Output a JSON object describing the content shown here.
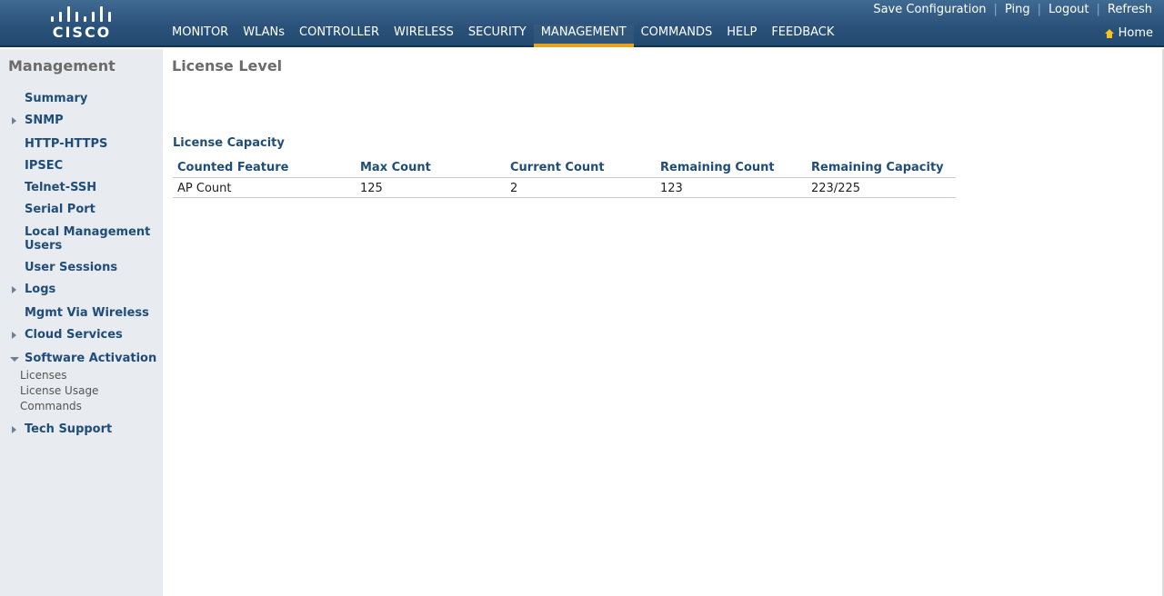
{
  "brand": {
    "logo_text": "CISCO"
  },
  "utility_links": [
    "Save Configuration",
    "Ping",
    "Logout",
    "Refresh"
  ],
  "home_link": "Home",
  "nav": {
    "items": [
      "MONITOR",
      "WLANs",
      "CONTROLLER",
      "WIRELESS",
      "SECURITY",
      "MANAGEMENT",
      "COMMANDS",
      "HELP",
      "FEEDBACK"
    ],
    "active": "MANAGEMENT",
    "accent_color": "#e8a31e"
  },
  "sidebar": {
    "title": "Management",
    "items": [
      {
        "label": "Summary",
        "arrow": "none"
      },
      {
        "label": "SNMP",
        "arrow": "right"
      },
      {
        "label": "HTTP-HTTPS",
        "arrow": "none"
      },
      {
        "label": "IPSEC",
        "arrow": "none"
      },
      {
        "label": "Telnet-SSH",
        "arrow": "none"
      },
      {
        "label": "Serial Port",
        "arrow": "none"
      },
      {
        "label_line1": "Local Management",
        "label_line2": "Users",
        "arrow": "none"
      },
      {
        "label": "User Sessions",
        "arrow": "none"
      },
      {
        "label": "Logs",
        "arrow": "right"
      },
      {
        "label": "Mgmt Via Wireless",
        "arrow": "none"
      },
      {
        "label": "Cloud Services",
        "arrow": "right"
      },
      {
        "label": "Software Activation",
        "arrow": "down"
      },
      {
        "label": "Tech Support",
        "arrow": "right"
      }
    ],
    "software_activation_sub": [
      "Licenses",
      "License Usage",
      "Commands"
    ]
  },
  "main": {
    "page_title": "License Level",
    "section_title": "License Capacity",
    "columns": [
      "Counted Feature",
      "Max Count",
      "Current Count",
      "Remaining Count",
      "Remaining Capacity"
    ],
    "rows": [
      [
        "AP Count",
        "125",
        "2",
        "123",
        "223/225"
      ]
    ]
  }
}
